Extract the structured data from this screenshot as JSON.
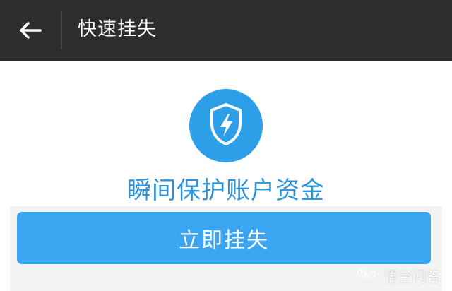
{
  "header": {
    "title": "快速挂失",
    "back_icon": "arrow-left-icon"
  },
  "main": {
    "shield_icon": "shield-lightning-icon",
    "headline": "瞬间保护账户资金",
    "action_label": "立即挂失"
  },
  "watermark": {
    "text": "悟空问答",
    "icon": "swirl-logo-icon"
  },
  "colors": {
    "header_bg": "#2d2d2d",
    "accent": "#2d9fe8",
    "headline": "#2a93da",
    "button": "#3aa5f1",
    "page_bg": "#ffffff"
  }
}
